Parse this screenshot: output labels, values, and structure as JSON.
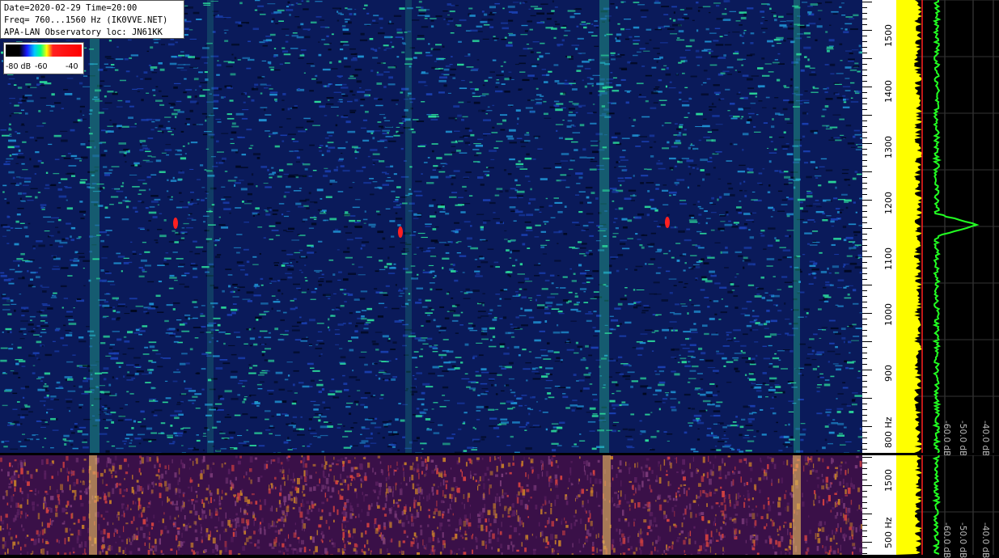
{
  "info": {
    "line1": "Date=2020-02-29 Time=20:00",
    "line2": "Freq= 760...1560 Hz (IK0VVE.NET)",
    "line3": "APA-LAN Observatory loc: JN61KK"
  },
  "scale": {
    "label_min": "-80 dB",
    "label_mid": "-60",
    "label_max": "-40"
  },
  "axis_main": {
    "labels": [
      "1500",
      "1400",
      "1300",
      "1200",
      "1100",
      "1000",
      "900",
      "800 Hz"
    ]
  },
  "axis_low": {
    "labels": [
      "1500",
      "500 Hz"
    ]
  },
  "spectrum_main": {
    "db_labels": [
      "-60.0 dB",
      "-50.0 dB",
      "-40.0 dB"
    ]
  },
  "spectrum_low": {
    "db_labels": [
      "-60.0 dB",
      "-50.0 dB",
      "-40.0 dB"
    ]
  },
  "colors": {
    "waterfall_bg": "#0a1a5a",
    "waterfall_noise_1": "#1a3fb0",
    "waterfall_noise_2": "#1e8fd0",
    "waterfall_noise_3": "#2ad89a",
    "low_bg": "#3a1048",
    "low_noise": "#c07a2a",
    "low_bright": "#f0c060",
    "spectrum_fill": "#ffff00",
    "spectrum_line": "#22ff22",
    "marker_red": "#ff2020"
  }
}
